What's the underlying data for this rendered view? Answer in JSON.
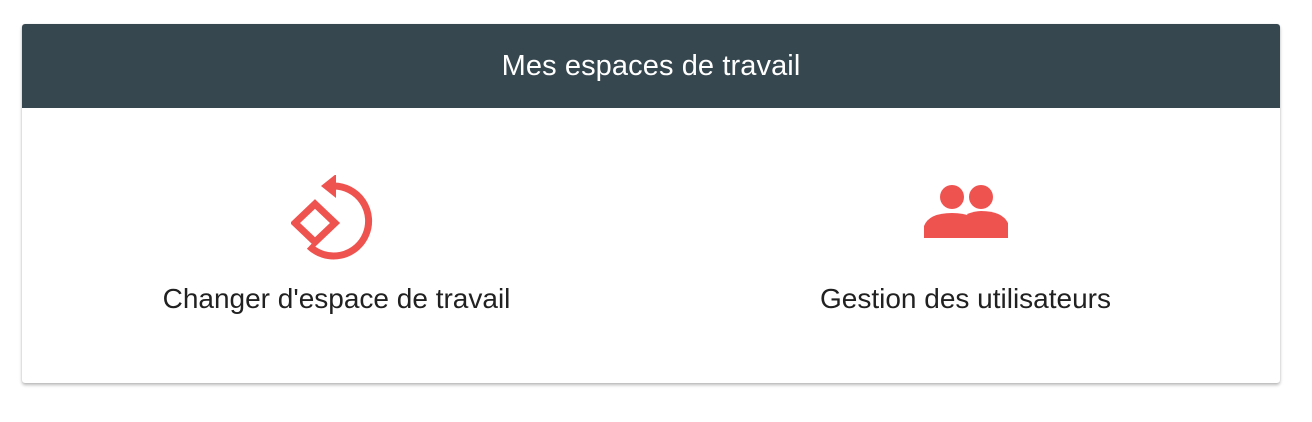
{
  "header": {
    "title": "Mes espaces de travail"
  },
  "actions": [
    {
      "label": "Changer d'espace de travail",
      "icon": "switch-workspace-icon"
    },
    {
      "label": "Gestion des utilisateurs",
      "icon": "users-icon"
    }
  ],
  "colors": {
    "header_bg": "#37474f",
    "accent": "#ef5350",
    "text": "#212121"
  }
}
